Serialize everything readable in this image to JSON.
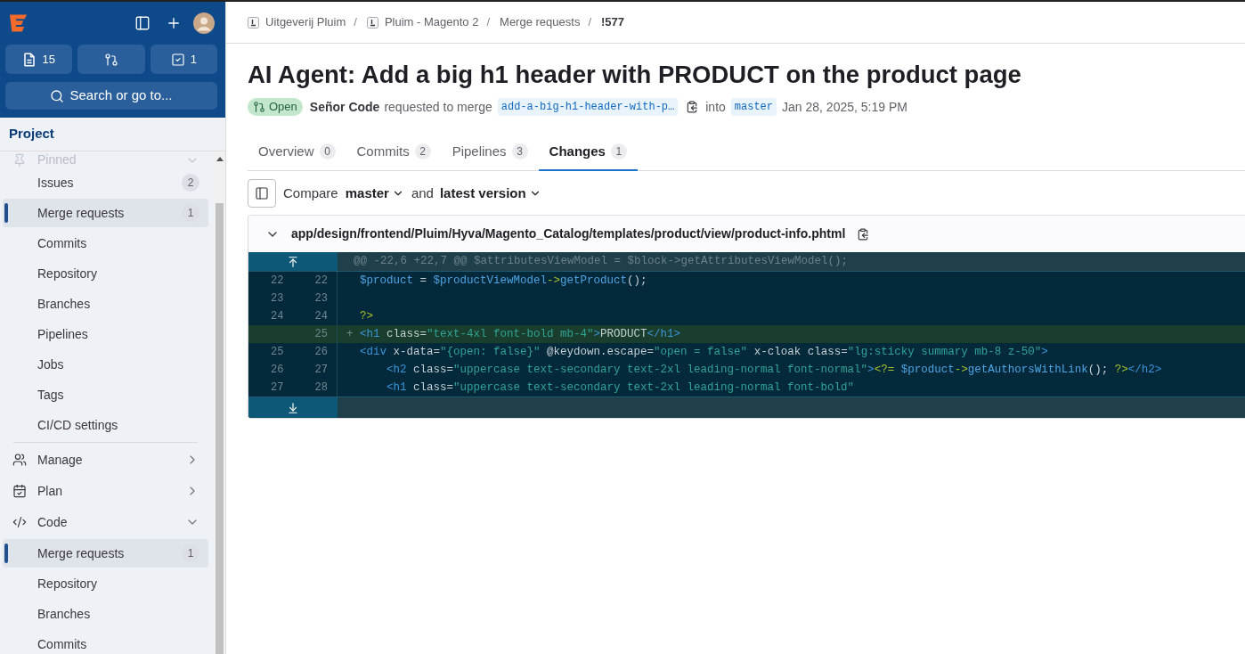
{
  "sidebar": {
    "shortcuts": [
      {
        "kind": "issues",
        "count": "15"
      },
      {
        "kind": "merge_requests"
      },
      {
        "kind": "todos",
        "count": "1"
      }
    ],
    "search": {
      "label": "Search or go to..."
    },
    "section_title": "Project",
    "groups": [
      {
        "kind": "pinned",
        "label": "Pinned",
        "expanded": true,
        "children": [
          {
            "label": "Issues",
            "count": "2",
            "selected": false
          },
          {
            "label": "Merge requests",
            "count": "1",
            "selected": true
          },
          {
            "label": "Commits",
            "selected": false
          },
          {
            "label": "Repository",
            "selected": false
          },
          {
            "label": "Branches",
            "selected": false
          },
          {
            "label": "Pipelines",
            "selected": false
          },
          {
            "label": "Jobs",
            "selected": false
          },
          {
            "label": "Tags",
            "selected": false
          },
          {
            "label": "CI/CD settings",
            "selected": false
          }
        ]
      },
      {
        "kind": "manage",
        "label": "Manage",
        "expanded": false
      },
      {
        "kind": "plan",
        "label": "Plan",
        "expanded": false
      },
      {
        "kind": "code",
        "label": "Code",
        "expanded": true,
        "children": [
          {
            "label": "Merge requests",
            "count": "1",
            "selected": true
          },
          {
            "label": "Repository",
            "selected": false
          },
          {
            "label": "Branches",
            "selected": false
          },
          {
            "label": "Commits",
            "selected": false
          }
        ]
      }
    ]
  },
  "breadcrumbs": [
    {
      "label": "Uitgeverij Pluim",
      "avatar": true,
      "current": false,
      "separator": "/"
    },
    {
      "label": "Pluim - Magento 2",
      "avatar": true,
      "current": false,
      "separator": "/"
    },
    {
      "label": "Merge requests",
      "avatar": false,
      "current": false,
      "separator": "/"
    },
    {
      "label": "!577",
      "avatar": false,
      "current": true
    }
  ],
  "merge_request": {
    "title": "AI Agent: Add a big h1 header with PRODUCT on the product page",
    "status": "Open",
    "author": "Señor Code",
    "action": "requested to merge",
    "source_branch": "add-a-big-h1-header-with-p…",
    "connector": "into",
    "target_branch": "master",
    "created": "Jan 28, 2025, 5:19 PM"
  },
  "tabs": [
    {
      "label": "Overview",
      "count": "0",
      "selected": false
    },
    {
      "label": "Commits",
      "count": "2",
      "selected": false
    },
    {
      "label": "Pipelines",
      "count": "3",
      "selected": false
    },
    {
      "label": "Changes",
      "count": "1",
      "selected": true
    }
  ],
  "compare": {
    "label": "Compare",
    "base": "master",
    "joiner": "and",
    "head": "latest version"
  },
  "file": {
    "path": "app/design/frontend/Pluim/Hyva/Magento_Catalog/templates/product/view/product-info.phtml",
    "expanded": true,
    "rows": [
      {
        "kind": "hunk",
        "text": "@@ -22,6 +22,7 @@ $attributesViewModel = $block->getAttributesViewModel();"
      },
      {
        "kind": "context",
        "old": "22",
        "new": "22",
        "indented": false,
        "tokens": [
          {
            "kind": "variable",
            "text": "$product"
          },
          {
            "kind": "plain",
            "text": " = "
          },
          {
            "kind": "variable",
            "text": "$productViewModel"
          },
          {
            "kind": "keyword",
            "text": "->"
          },
          {
            "kind": "function",
            "text": "getProduct"
          },
          {
            "kind": "plain",
            "text": "();"
          }
        ]
      },
      {
        "kind": "context",
        "old": "23",
        "new": "23"
      },
      {
        "kind": "context",
        "old": "24",
        "new": "24",
        "indented": false,
        "tokens": [
          {
            "kind": "keyword",
            "text": "?>"
          }
        ]
      },
      {
        "kind": "added",
        "new": "25",
        "sign": "+",
        "indented": false,
        "tokens": [
          {
            "kind": "tag",
            "text": "<h1"
          },
          {
            "kind": "attr",
            "text": " class="
          },
          {
            "kind": "string",
            "text": "\"text-4xl font-bold mb-4\""
          },
          {
            "kind": "tag",
            "text": ">"
          },
          {
            "kind": "plain",
            "text": "PRODUCT"
          },
          {
            "kind": "tag",
            "text": "</h1>"
          }
        ]
      },
      {
        "kind": "context",
        "old": "25",
        "new": "26",
        "indented": false,
        "tokens": [
          {
            "kind": "tag",
            "text": "<div"
          },
          {
            "kind": "attr",
            "text": " x-data="
          },
          {
            "kind": "string",
            "text": "\"{open: false}\""
          },
          {
            "kind": "attr",
            "text": " @keydown.escape="
          },
          {
            "kind": "string",
            "text": "\"open = false\""
          },
          {
            "kind": "attr",
            "text": " x-cloak class="
          },
          {
            "kind": "string",
            "text": "\"lg:sticky summary mb-8 z-50\""
          },
          {
            "kind": "tag",
            "text": ">"
          }
        ]
      },
      {
        "kind": "context",
        "old": "26",
        "new": "27",
        "indented": true,
        "tokens": [
          {
            "kind": "tag",
            "text": "<h2"
          },
          {
            "kind": "attr",
            "text": " class="
          },
          {
            "kind": "string",
            "text": "\"uppercase text-secondary text-2xl leading-normal font-normal\""
          },
          {
            "kind": "tag",
            "text": ">"
          },
          {
            "kind": "keyword",
            "text": "<?="
          },
          {
            "kind": "variable",
            "text": " $product"
          },
          {
            "kind": "keyword",
            "text": "->"
          },
          {
            "kind": "function",
            "text": "getAuthorsWithLink"
          },
          {
            "kind": "plain",
            "text": "();"
          },
          {
            "kind": "keyword",
            "text": " ?>"
          },
          {
            "kind": "tag",
            "text": "</h2>"
          }
        ]
      },
      {
        "kind": "context",
        "old": "27",
        "new": "28",
        "indented": true,
        "tokens": [
          {
            "kind": "tag",
            "text": "<h1"
          },
          {
            "kind": "attr",
            "text": " class="
          },
          {
            "kind": "string",
            "text": "\"uppercase text-secondary text-2xl leading-normal font-bold\""
          }
        ]
      },
      {
        "kind": "expand"
      }
    ]
  }
}
